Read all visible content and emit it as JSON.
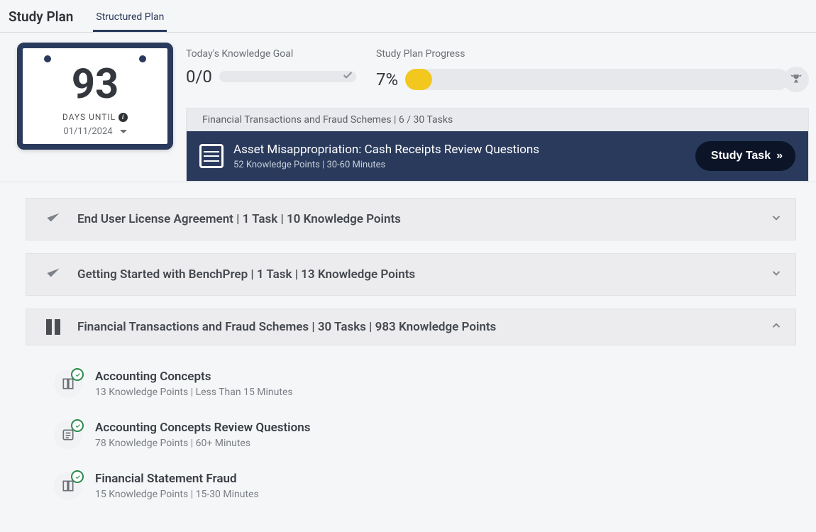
{
  "tabs": {
    "title": "Study Plan",
    "active": "Structured Plan"
  },
  "calendar": {
    "days": "93",
    "label": "DAYS UNTIL",
    "date": "01/11/2024"
  },
  "goal": {
    "label": "Today's Knowledge Goal",
    "value": "0/0",
    "fill_pct": 0
  },
  "progress": {
    "label": "Study Plan Progress",
    "value": "7%",
    "fill_pct": 7
  },
  "current_task": {
    "header": "Financial Transactions and Fraud Schemes | 6 / 30 Tasks",
    "title": "Asset Misappropriation: Cash Receipts Review Questions",
    "subtitle": "52 Knowledge Points |  30-60 Minutes",
    "button": "Study Task"
  },
  "sections": [
    {
      "status": "done",
      "title": "End User License Agreement | 1 Task | 10 Knowledge Points",
      "expanded": false
    },
    {
      "status": "done",
      "title": "Getting Started with BenchPrep | 1 Task | 13 Knowledge Points",
      "expanded": false
    },
    {
      "status": "in_progress",
      "title": "Financial Transactions and Fraud Schemes | 30 Tasks | 983 Knowledge Points",
      "expanded": true,
      "items": [
        {
          "icon": "book",
          "complete": true,
          "title": "Accounting Concepts",
          "subtitle": "13 Knowledge Points |  Less Than 15 Minutes"
        },
        {
          "icon": "list",
          "complete": true,
          "title": "Accounting Concepts Review Questions",
          "subtitle": "78 Knowledge Points |  60+ Minutes"
        },
        {
          "icon": "book",
          "complete": true,
          "title": "Financial Statement Fraud",
          "subtitle": "15 Knowledge Points |  15-30 Minutes"
        }
      ]
    }
  ]
}
